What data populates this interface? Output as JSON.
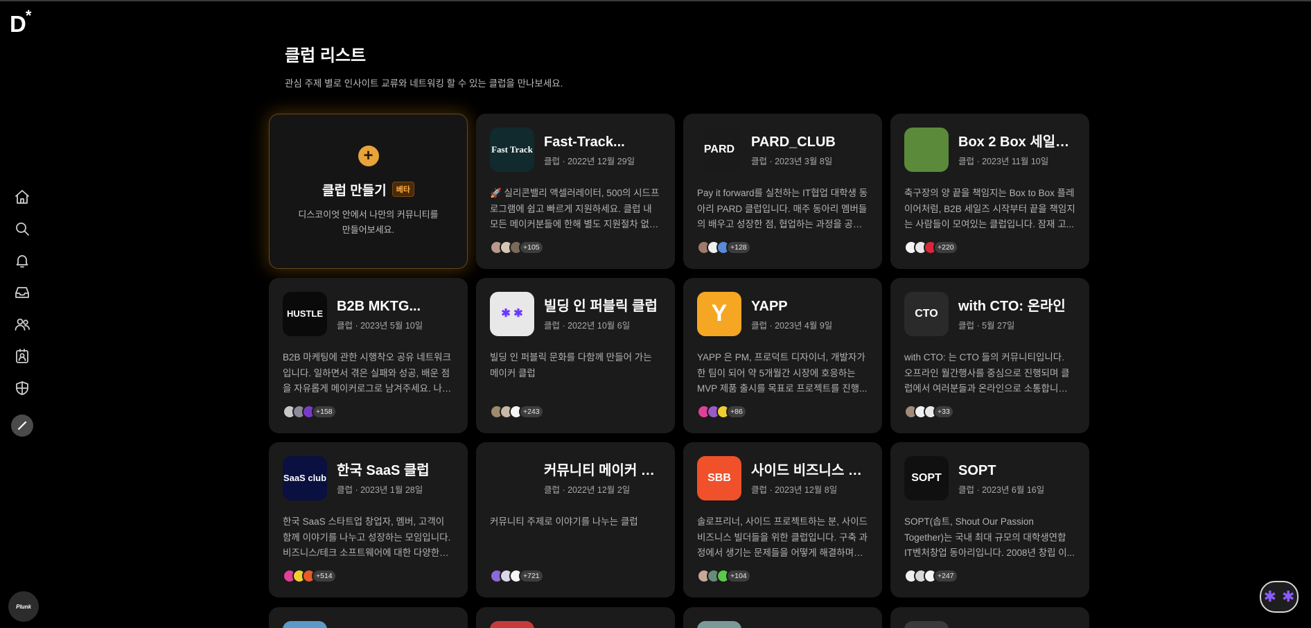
{
  "brand": {
    "logo_text": "D",
    "logo_mark": "*"
  },
  "page": {
    "title": "클럽 리스트",
    "subtitle": "관심 주제 별로 인사이트 교류와 네트워킹 할 수 있는 클럽을 만나보세요."
  },
  "sidebar": {
    "icons": [
      "home-icon",
      "search-icon",
      "bell-icon",
      "inbox-icon",
      "people-icon",
      "id-card-icon",
      "shield-icon"
    ],
    "write_icon": "pencil-icon",
    "user_avatar_text": "Plunk"
  },
  "create_card": {
    "title": "클럽 만들기",
    "badge": "베타",
    "desc_line1": "디스코이엇 안에서 나만의 커뮤니티를",
    "desc_line2": "만들어보세요."
  },
  "clubs": [
    {
      "name": "Fast-Track...",
      "meta": "클럽 · 2022년 12월 29일",
      "desc": "🚀 실리콘밸리 액셀러레이터, 500의 시드프로그램에 쉽고 빠르게 지원하세요. 클럽 내 모든 메이커분들에 한해 별도 지원절차 없이 I...",
      "members": "+105",
      "thumb_text": "Fast Track",
      "thumb_bg": "#102a2e",
      "dots": [
        "#b89a8a",
        "#d8c7b8",
        "#7a6a5a"
      ]
    },
    {
      "name": "PARD_CLUB",
      "meta": "클럽 · 2023년 3월 8일",
      "desc": "Pay it forward를 실천하는 IT협업 대학생 동아리 PARD 클럽입니다. 매주 동아리 멤버들의 배우고 성장한 점, 협업하는 과정을 공유...",
      "members": "+128",
      "thumb_text": "PARD",
      "thumb_bg": "#1a1a1a",
      "dots": [
        "#a07a6a",
        "#f0f0f0",
        "#5a8ad8"
      ]
    },
    {
      "name": "Box 2 Box 세일즈...",
      "meta": "클럽 · 2023년 11월 10일",
      "desc": "축구장의 양 끝을 책임지는 Box to Box 플레이어처럼, B2B 세일즈 시작부터 끝을 책임지는 사람들이 모여있는 클럽입니다. 잠재 고...",
      "members": "+220",
      "thumb_text": "",
      "thumb_bg": "#5a8a3a",
      "dots": [
        "#f5f5f5",
        "#e8e8e8",
        "#d8283a"
      ]
    },
    {
      "name": "B2B MKTG...",
      "meta": "클럽 · 2023년 5월 10일",
      "desc": "B2B 마케팅에 관한 시행착오 공유 네트워크입니다. 일하면서 겪은 실패와 성공, 배운 점을 자유롭게 메이커로그로 남겨주세요. 나와 다...",
      "members": "+158",
      "thumb_text": "HUSTLE",
      "thumb_bg": "#0a0a0a",
      "dots": [
        "#c8c8c8",
        "#8a8a9a",
        "#7a3ac8"
      ]
    },
    {
      "name": "빌딩 인 퍼블릭 클럽",
      "meta": "클럽 · 2022년 10월 6일",
      "desc": "빌딩 인 퍼블릭 문화를 다함께 만들어 가는 메이커 클럽",
      "members": "+243",
      "thumb_text": "✱ ✱",
      "thumb_bg": "#e8e8e8",
      "dots": [
        "#a08a6a",
        "#c8b8a8",
        "#f5f5f5"
      ]
    },
    {
      "name": "YAPP",
      "meta": "클럽 · 2023년 4월 9일",
      "desc": "YAPP 은 PM, 프로덕트 디자이너, 개발자가 한 팀이 되어 약 5개월간 시장에 호응하는 MVP 제품 출시를 목표로 프로젝트를 진행...",
      "members": "+86",
      "thumb_text": "Y",
      "thumb_bg": "#f5a623",
      "dots": [
        "#e0409a",
        "#9a5ac8",
        "#f0d030"
      ]
    },
    {
      "name": "with CTO: 온라인",
      "meta": "클럽 · 5월 27일",
      "desc": "with CTO: 는 CTO 들의 커뮤니티입니다. 오프라인 월간행사를 중심으로 진행되며 클럽에서 여러분들과 온라인으로 소통합니다. 바쁜...",
      "members": "+33",
      "thumb_text": "CTO",
      "thumb_bg": "#2a2a2a",
      "dots": [
        "#a08a7a",
        "#f0f0f0",
        "#e8e8e8"
      ]
    },
    {
      "name": "한국 SaaS 클럽",
      "meta": "클럽 · 2023년 1월 28일",
      "desc": "한국 SaaS 스타트업 창업자, 멤버, 고객이 함께 이야기를 나누고 성장하는 모임입니다. 비즈니스/테크 소프트웨어에 대한 다양한 이...",
      "members": "+514",
      "thumb_text": "SaaS club",
      "thumb_bg": "#0a1040",
      "dots": [
        "#e0409a",
        "#f0d030",
        "#e85a2a"
      ]
    },
    {
      "name": "커뮤니티 메이커 클럽",
      "meta": "클럽 · 2022년 12월 2일",
      "desc": "커뮤니티 주제로 이야기를 나누는 클럽",
      "members": "+721",
      "thumb_text": "",
      "thumb_bg": "#1b1b1b",
      "dots": [
        "#8a6ad8",
        "#d8d8e8",
        "#f5f5f5"
      ]
    },
    {
      "name": "사이드 비즈니스 빌더",
      "meta": "클럽 · 2023년 12월 8일",
      "desc": "솔로프리너, 사이드 프로젝트하는 분, 사이드 비즈니스 빌더들을 위한 클럽입니다. 구축 과정에서 생기는 문제들을 어떻게 해결하며 비...",
      "members": "+104",
      "thumb_text": "SBB",
      "thumb_bg": "#f0502a",
      "dots": [
        "#c8a898",
        "#6a8a7a",
        "#5ac84a"
      ]
    },
    {
      "name": "SOPT",
      "meta": "클럽 · 2023년 6월 16일",
      "desc": "SOPT(솝트, Shout Our Passion Together)는 국내 최대 규모의 대학생연합 IT벤처창업 동아리입니다. 2008년 창립 이...",
      "members": "+247",
      "thumb_text": "SOPT",
      "thumb_bg": "#101010",
      "dots": [
        "#f0f0f0",
        "#d8d8d8",
        "#f5f5f5"
      ]
    }
  ],
  "partial_thumbs": [
    "#5a9ac8",
    "#c83a3a",
    "#7a9a9a",
    "#3a3a3a"
  ],
  "floating_button": {
    "glyph": "✱"
  }
}
